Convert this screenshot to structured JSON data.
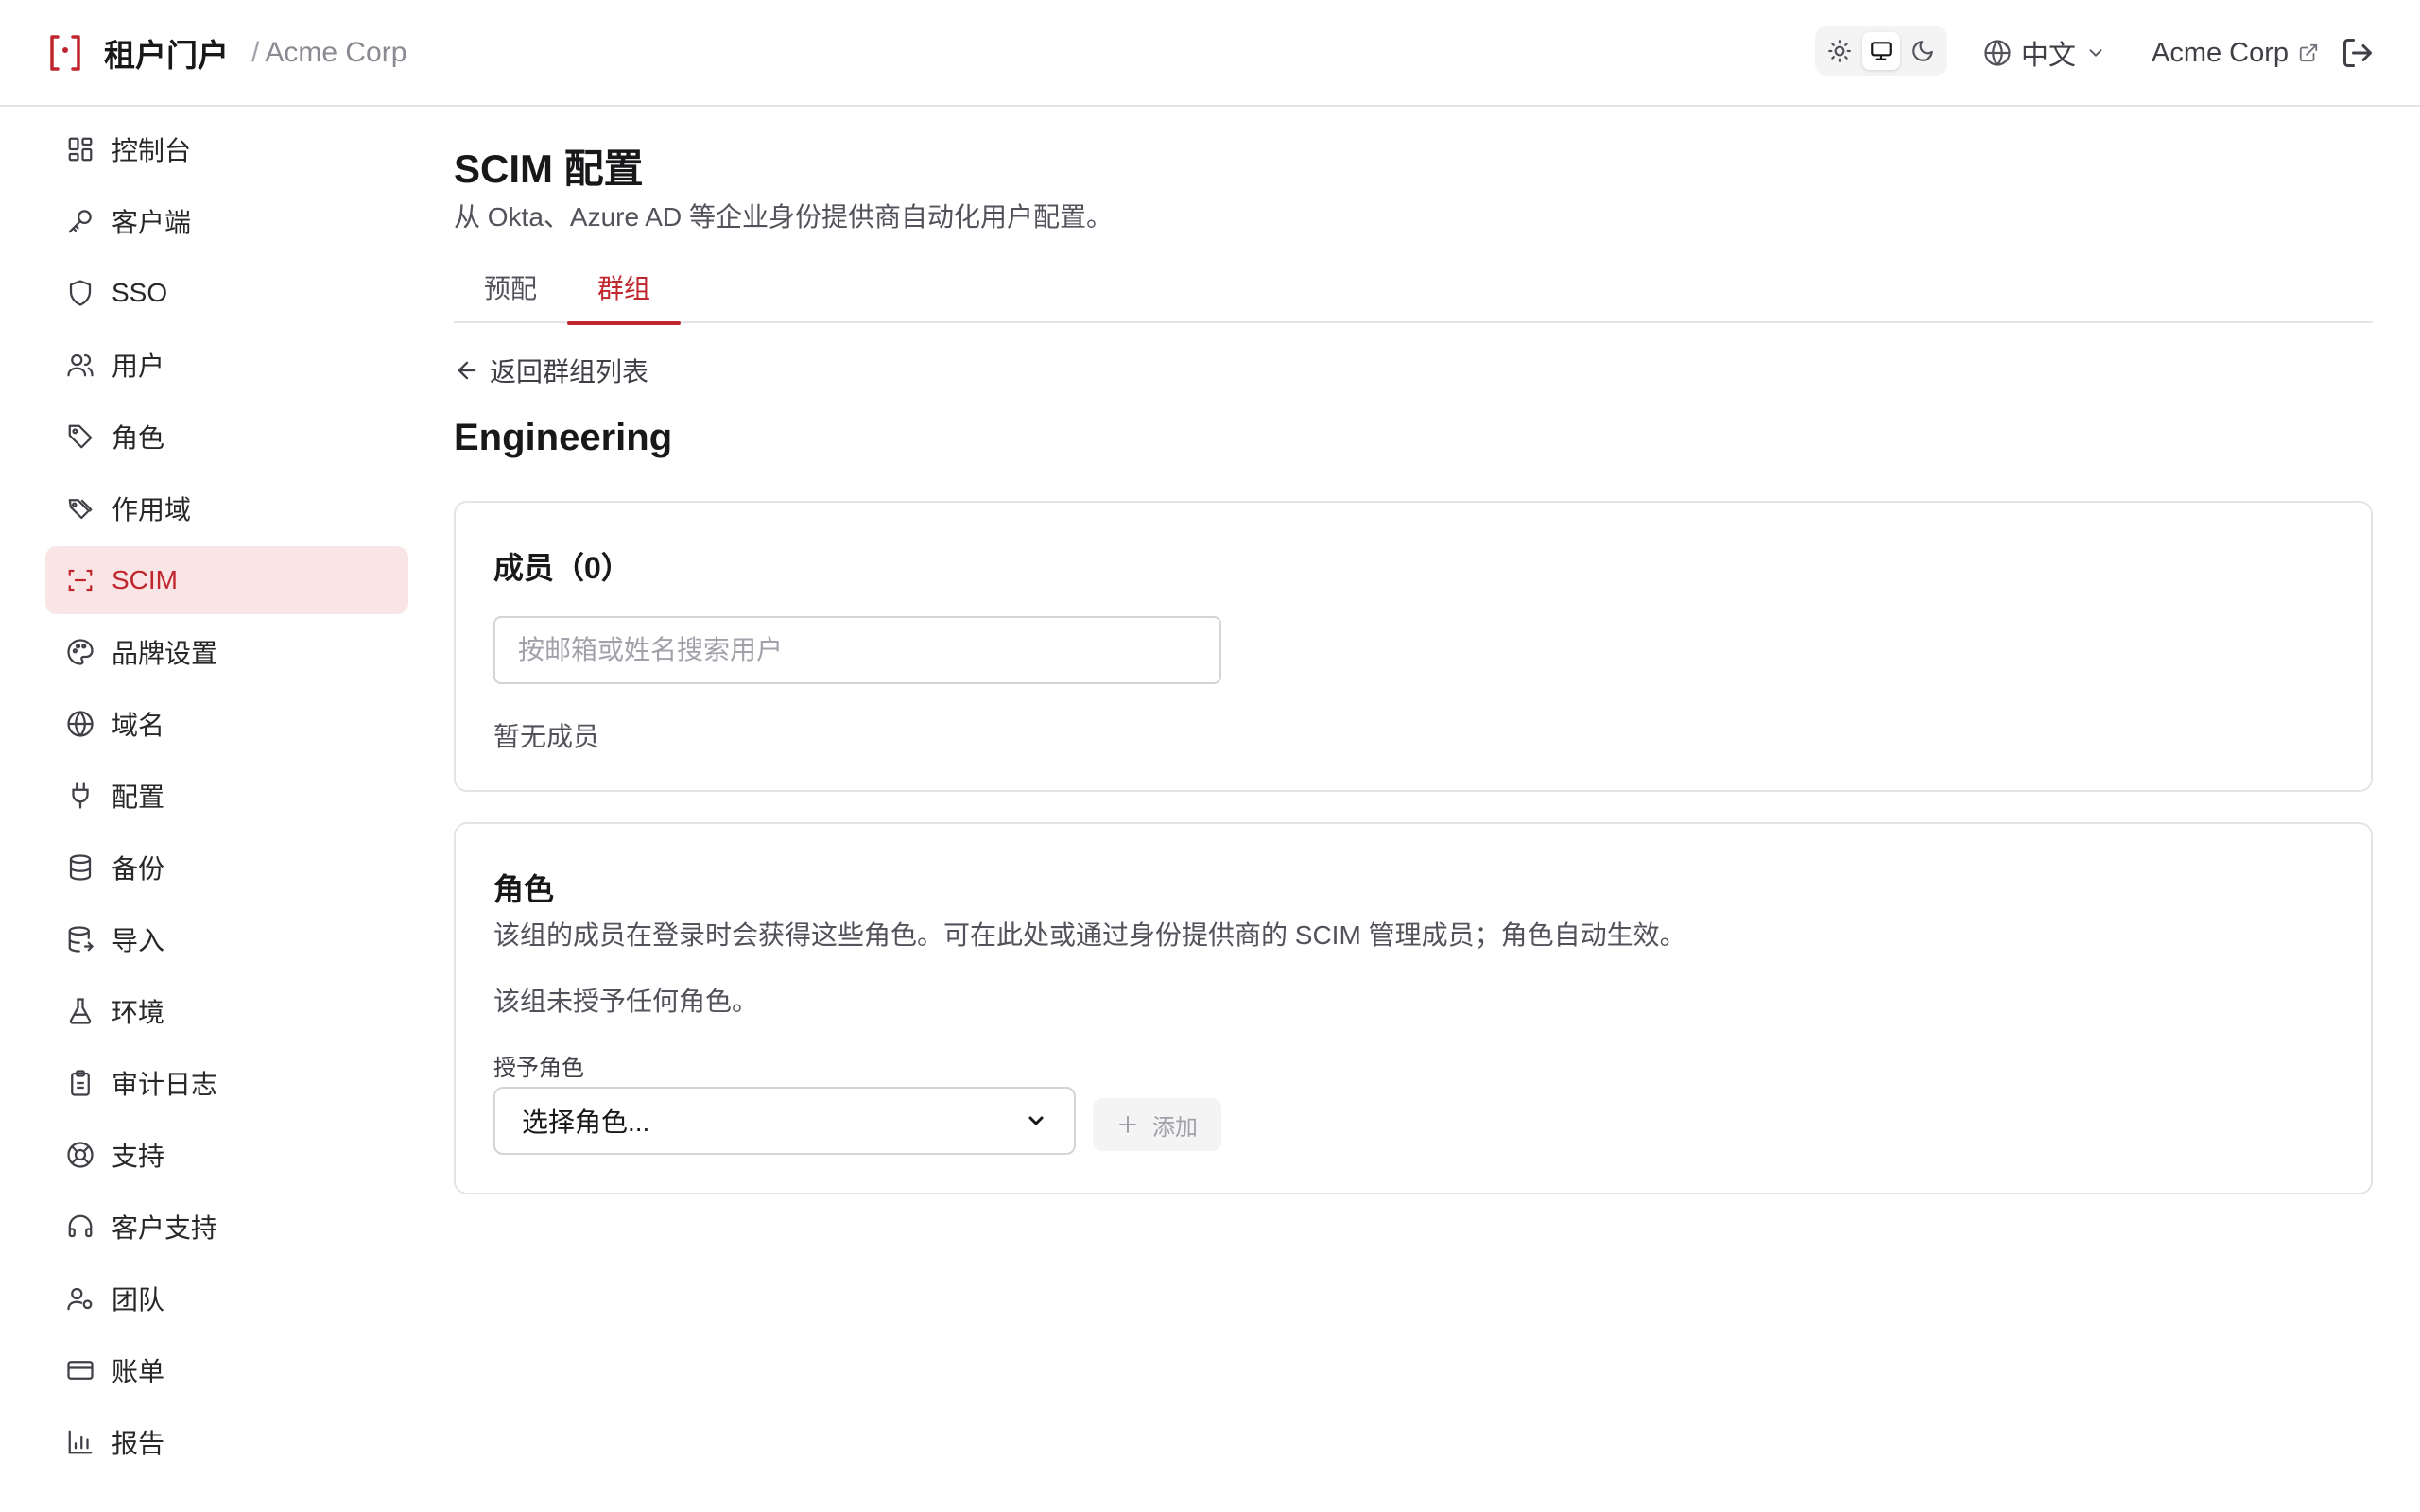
{
  "header": {
    "app_title": "租户门户",
    "separator": "/",
    "tenant_name": "Acme Corp",
    "language": "中文",
    "account_name": "Acme Corp",
    "theme_options": [
      "sun-icon",
      "monitor-icon",
      "moon-icon"
    ],
    "active_theme": "monitor-icon"
  },
  "sidebar": {
    "items": [
      {
        "label": "控制台",
        "icon": "dashboard-icon"
      },
      {
        "label": "客户端",
        "icon": "key-icon"
      },
      {
        "label": "SSO",
        "icon": "shield-icon"
      },
      {
        "label": "用户",
        "icon": "users-icon"
      },
      {
        "label": "角色",
        "icon": "tag-icon"
      },
      {
        "label": "作用域",
        "icon": "tags-icon"
      },
      {
        "label": "SCIM",
        "icon": "scan-icon",
        "active": true
      },
      {
        "label": "品牌设置",
        "icon": "palette-icon"
      },
      {
        "label": "域名",
        "icon": "globe-icon"
      },
      {
        "label": "配置",
        "icon": "plug-icon"
      },
      {
        "label": "备份",
        "icon": "database-icon"
      },
      {
        "label": "导入",
        "icon": "database-import-icon"
      },
      {
        "label": "环境",
        "icon": "flask-icon"
      },
      {
        "label": "审计日志",
        "icon": "clipboard-icon"
      },
      {
        "label": "支持",
        "icon": "lifebuoy-icon"
      },
      {
        "label": "客户支持",
        "icon": "headset-icon"
      },
      {
        "label": "团队",
        "icon": "user-cog-icon"
      },
      {
        "label": "账单",
        "icon": "credit-card-icon"
      },
      {
        "label": "报告",
        "icon": "bar-chart-icon"
      }
    ]
  },
  "main": {
    "title": "SCIM 配置",
    "subtitle": "从 Okta、Azure AD 等企业身份提供商自动化用户配置。",
    "tabs": [
      {
        "label": "预配",
        "active": false
      },
      {
        "label": "群组",
        "active": true
      }
    ],
    "back_link": "返回群组列表",
    "group_name": "Engineering",
    "members": {
      "title": "成员（0）",
      "search_placeholder": "按邮箱或姓名搜索用户",
      "empty_text": "暂无成员"
    },
    "roles": {
      "title": "角色",
      "description": "该组的成员在登录时会获得这些角色。可在此处或通过身份提供商的 SCIM 管理成员；角色自动生效。",
      "none_text": "该组未授予任何角色。",
      "grant_label": "授予角色",
      "select_value": "选择角色...",
      "add_button": "添加"
    }
  },
  "colors": {
    "accent": "#c0262d",
    "active_bg": "#f9e5e6",
    "border": "#e4e4e7"
  }
}
